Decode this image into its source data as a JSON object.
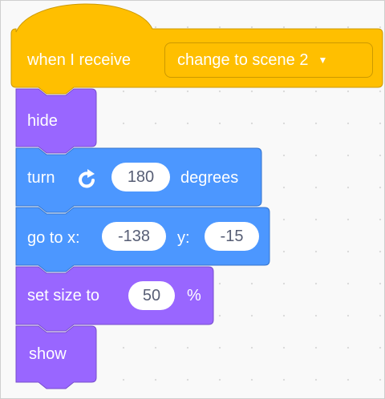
{
  "script": {
    "hat": {
      "label": "when I receive",
      "message": "change to scene 2",
      "dropdown_icon": "caret-down-icon",
      "color": "#ffbf00"
    },
    "hide": {
      "label": "hide",
      "color": "#9966ff"
    },
    "turn": {
      "label": "turn",
      "icon": "rotate-clockwise-icon",
      "value": "180",
      "suffix": "degrees",
      "color": "#4c97ff"
    },
    "goto": {
      "label": "go to x:",
      "x_value": "-138",
      "y_label": "y:",
      "y_value": "-15",
      "color": "#4c97ff"
    },
    "set_size": {
      "label": "set size to",
      "value": "50",
      "suffix": "%",
      "color": "#9966ff"
    },
    "show": {
      "label": "show",
      "color": "#9966ff"
    }
  }
}
